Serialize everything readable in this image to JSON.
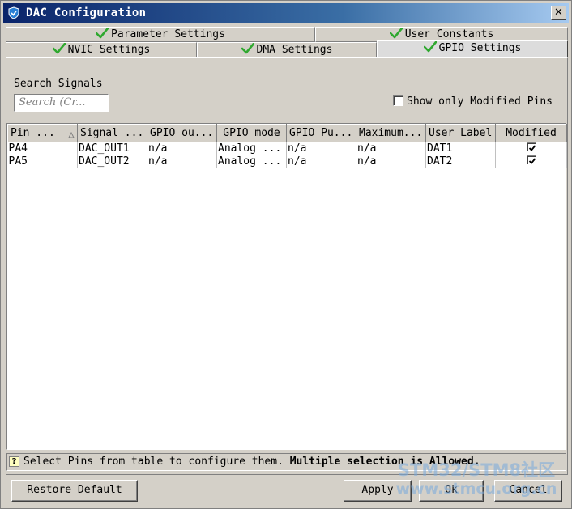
{
  "window": {
    "title": "DAC Configuration",
    "close_glyph": "✕"
  },
  "tabs": [
    {
      "label": "Parameter Settings",
      "active": false
    },
    {
      "label": "User Constants",
      "active": false
    },
    {
      "label": "NVIC Settings",
      "active": false
    },
    {
      "label": "DMA Settings",
      "active": false
    },
    {
      "label": "GPIO Settings",
      "active": true
    }
  ],
  "search": {
    "label": "Search Signals",
    "placeholder": "Search (Cr..."
  },
  "filter": {
    "label": "Show only Modified Pins",
    "checked": false
  },
  "table": {
    "columns": [
      "Pin ...",
      "Signal ...",
      "GPIO ou...",
      "GPIO mode",
      "GPIO Pu...",
      "Maximum...",
      "User Label",
      "Modified"
    ],
    "sort_column": "Pin ...",
    "rows": [
      {
        "pin": "PA4",
        "signal": "DAC_OUT1",
        "gpio_output": "n/a",
        "gpio_mode": "Analog ...",
        "gpio_pull": "n/a",
        "maximum": "n/a",
        "user_label": "DAT1",
        "modified": true
      },
      {
        "pin": "PA5",
        "signal": "DAC_OUT2",
        "gpio_output": "n/a",
        "gpio_mode": "Analog ...",
        "gpio_pull": "n/a",
        "maximum": "n/a",
        "user_label": "DAT2",
        "modified": true
      }
    ]
  },
  "status": {
    "text": "Select Pins from table to configure them.",
    "bold_text": "Multiple selection is Allowed."
  },
  "buttons": {
    "restore_default": "Restore Default",
    "apply": "Apply",
    "ok": "Ok",
    "cancel": "Cancel"
  },
  "watermark": {
    "line1": "STM32/STM8社区",
    "line2": "www.stmcu.org.cn"
  },
  "colors": {
    "title_start": "#0a246a",
    "title_end": "#a6caf0",
    "window_bg": "#d4d0c8",
    "check_green": "#2fa82f"
  },
  "icons": {
    "title": "shield-icon",
    "tab_status": "green-check-icon",
    "help": "question-icon"
  }
}
